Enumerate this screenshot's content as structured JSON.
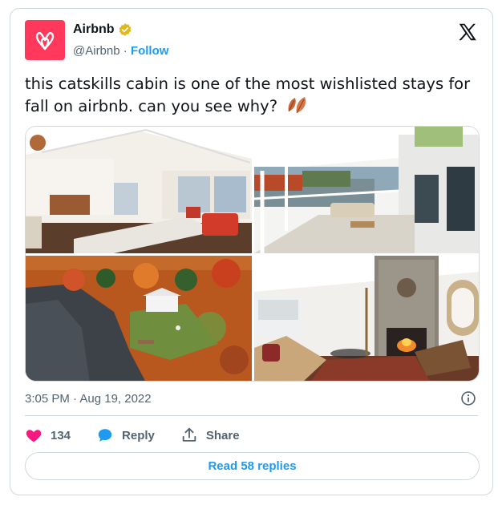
{
  "author": {
    "display_name": "Airbnb",
    "handle": "@Airbnb",
    "separator": " · ",
    "follow_label": "Follow",
    "brand_color": "#ff385c",
    "verified_badge_color": "#e2b719"
  },
  "tweet": {
    "text": "this catskills cabin is one of the most wishlisted stays for fall on airbnb. can you see why?",
    "emoji": "fallen-leaf-emoji",
    "timestamp": "3:05 PM · Aug 19, 2022"
  },
  "media": {
    "photos": [
      {
        "subject": "living-room-photo"
      },
      {
        "subject": "porch-lake-view-photo"
      },
      {
        "subject": "aerial-lake-cabin-photo"
      },
      {
        "subject": "fireplace-lounge-photo"
      }
    ]
  },
  "actions": {
    "likes_count": "134",
    "reply_label": "Reply",
    "share_label": "Share",
    "like_color": "#f91880",
    "reply_color": "#1d9bf0"
  },
  "read_replies_label": "Read 58 replies",
  "icons": {
    "logo": "x-logo-icon",
    "info": "info-icon",
    "verified": "verified-badge-icon"
  }
}
